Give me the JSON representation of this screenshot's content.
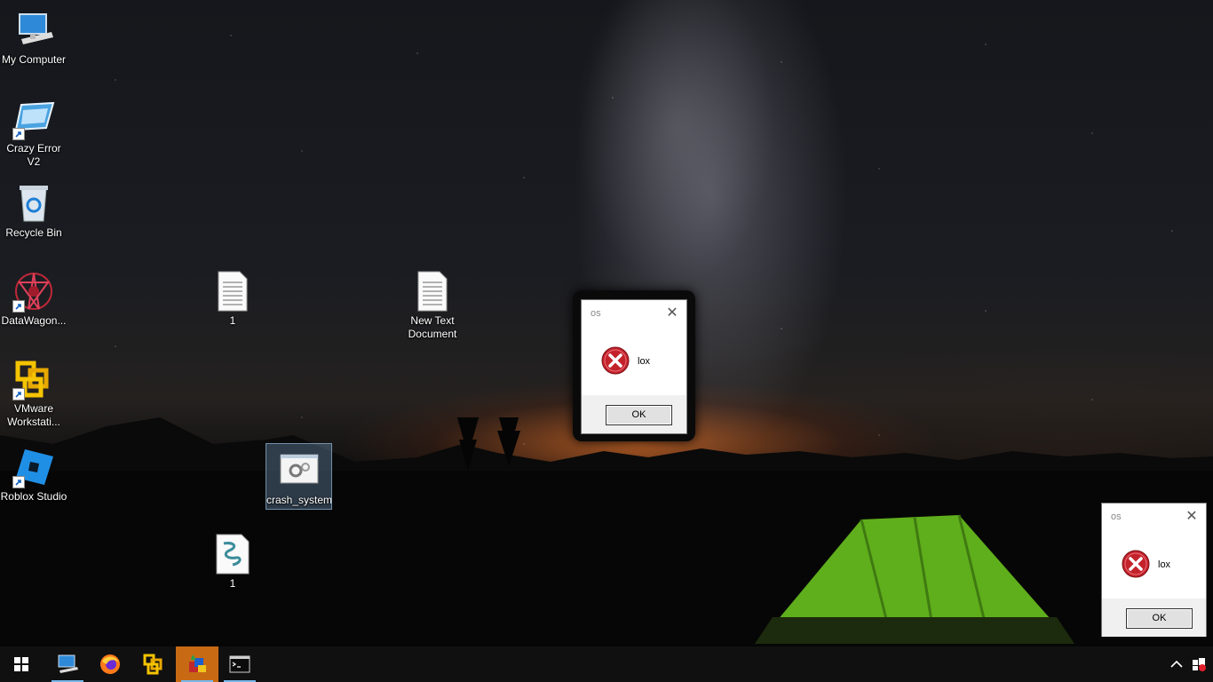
{
  "desktop": {
    "icons": [
      {
        "label": "My Computer",
        "icon": "computer-icon"
      },
      {
        "label": "Crazy Error V2",
        "icon": "crazy-error-icon"
      },
      {
        "label": "Recycle Bin",
        "icon": "recycle-bin-icon"
      },
      {
        "label": "DataWagon...",
        "icon": "datawagon-icon"
      },
      {
        "label": "VMware Workstati...",
        "icon": "vmware-icon"
      },
      {
        "label": "Roblox Studio",
        "icon": "roblox-studio-icon"
      },
      {
        "label": "1",
        "icon": "text-file-icon"
      },
      {
        "label": "New Text Document",
        "icon": "text-file-icon"
      },
      {
        "label": "crash_system",
        "icon": "executable-icon"
      },
      {
        "label": "1",
        "icon": "script-file-icon"
      }
    ]
  },
  "dialogs": [
    {
      "title": "os",
      "message": "lox",
      "ok_label": "OK",
      "icon": "error-icon"
    },
    {
      "title": "os",
      "message": "lox",
      "ok_label": "OK",
      "icon": "error-icon"
    }
  ],
  "taskbar": {
    "start_icon": "windows-start-icon",
    "apps": [
      {
        "name": "my-computer",
        "icon": "computer-icon"
      },
      {
        "name": "firefox",
        "icon": "firefox-icon"
      },
      {
        "name": "vmware",
        "icon": "vmware-icon"
      },
      {
        "name": "installer",
        "icon": "installer-icon"
      },
      {
        "name": "command-prompt",
        "icon": "terminal-icon"
      }
    ],
    "tray": [
      "chevron-up-icon",
      "notification-icon"
    ]
  },
  "colors": {
    "taskbar_bg": "#101010",
    "active_app": "#c86a14",
    "running_underline": "#76b9ed",
    "error_red": "#c4222b"
  }
}
